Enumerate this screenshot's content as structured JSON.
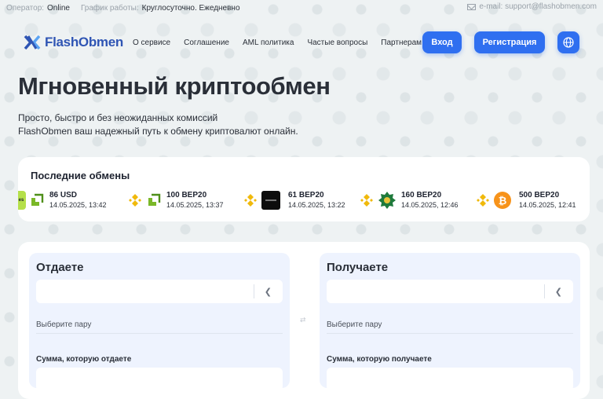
{
  "topbar": {
    "operator_label": "Оператор:",
    "operator_value": "Online",
    "schedule_label": "График работы:",
    "schedule_value": "Круглосуточно. Ежедневно",
    "email": "e-mail: support@flashobmen.com"
  },
  "nav": {
    "logo_text": "FlashObmen",
    "links": [
      "О сервисе",
      "Соглашение",
      "AML политика",
      "Частые вопросы",
      "Партнерам"
    ],
    "login": "Вход",
    "register": "Регистрация"
  },
  "hero": {
    "title": "Мгновенный криптообмен",
    "line1": "Просто, быстро и без неожиданных комиссий",
    "line2": "FlashObmen ваш надежный путь к обмену криптовалют онлайн."
  },
  "recent": {
    "title": "Последние обмены",
    "items": [
      {
        "from_icon": "green-card-icon",
        "to_icon": "payeer-icon",
        "amount": "86 USD",
        "date": "14.05.2025, 13:42"
      },
      {
        "from_icon": "bnb-icon",
        "to_icon": "payeer-icon",
        "amount": "100 BEP20",
        "date": "14.05.2025, 13:37"
      },
      {
        "from_icon": "bnb-icon",
        "to_icon": "dark-card-icon",
        "amount": "61 BEP20",
        "date": "14.05.2025, 13:22"
      },
      {
        "from_icon": "bnb-icon",
        "to_icon": "green-star-icon",
        "amount": "160 BEP20",
        "date": "14.05.2025, 12:46"
      },
      {
        "from_icon": "bnb-icon",
        "to_icon": "bitcoin-icon",
        "amount": "500 BEP20",
        "date": "14.05.2025, 12:41"
      }
    ]
  },
  "exchange": {
    "give_title": "Отдаете",
    "get_title": "Получаете",
    "pair_hint": "Выберите пару",
    "give_amount_label": "Сумма, которую отдаете",
    "get_amount_label": "Сумма, которую получаете"
  },
  "colors": {
    "accent": "#2f6ff0",
    "brand": "#2f55b4",
    "page_bg": "#eef2f3",
    "card_bg": "#eef3fe"
  }
}
